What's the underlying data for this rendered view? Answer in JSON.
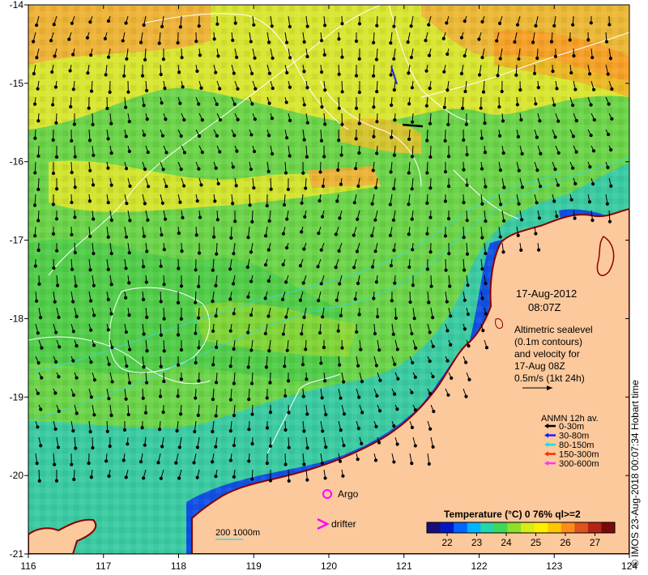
{
  "map": {
    "date": "17-Aug-2012",
    "time": "08:07Z",
    "x_ticks": [
      "116",
      "117",
      "118",
      "119",
      "120",
      "121",
      "122",
      "123",
      "124"
    ],
    "y_ticks": [
      "-14",
      "-15",
      "-16",
      "-17",
      "-18",
      "-19",
      "-20",
      "-21"
    ],
    "altimetry_note": [
      "Altimetric sealevel",
      "(0.1m contours)",
      "and velocity for",
      "17-Aug 08Z",
      "0.5m/s (1kt 24h)"
    ],
    "anmn": {
      "title": "ANMN 12h av.",
      "items": [
        {
          "label": "0-30m",
          "color": "#000000"
        },
        {
          "label": "30-80m",
          "color": "#1a1aff"
        },
        {
          "label": "80-150m",
          "color": "#00e5e5"
        },
        {
          "label": "150-300m",
          "color": "#ff2a00"
        },
        {
          "label": "300-600m",
          "color": "#ff33ff"
        }
      ]
    },
    "argo_label": "Argo",
    "drifter_label": "drifter",
    "isobath_label": "200  1000m",
    "colorbar": {
      "title": "Temperature (°C) 0 76% ql>=2",
      "ticks": [
        "22",
        "23",
        "24",
        "25",
        "26",
        "27"
      ],
      "colors": [
        "#1a0d7a",
        "#0018c8",
        "#0066ff",
        "#00b4ff",
        "#24d6a8",
        "#3ed85a",
        "#8ee02a",
        "#d8ec16",
        "#fff000",
        "#ffc800",
        "#ff8c1a",
        "#e0521e",
        "#b42414",
        "#7a0a0a"
      ]
    },
    "credit": "© IMOS 23-Aug-2018 00:07:34 Hobart time",
    "colors": {
      "land": "#fcc99c",
      "coast": "#8a0000",
      "contour": "#ffffff",
      "isobath": "#36d8e0"
    }
  }
}
